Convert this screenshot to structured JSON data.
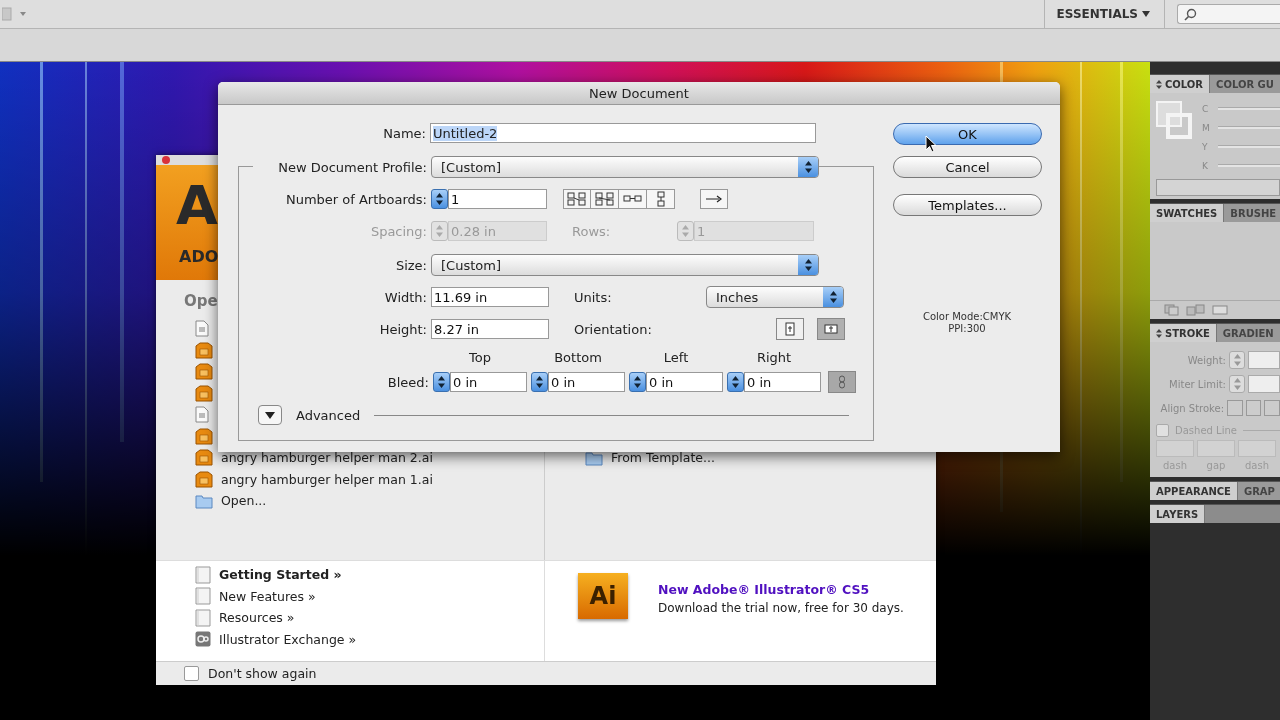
{
  "app_bar": {
    "workspace": "ESSENTIALS"
  },
  "welcome": {
    "logo_letter": "A",
    "logo_text": "ADO",
    "open_heading": "Ope",
    "recent_files": [
      {
        "kind": "doc"
      },
      {
        "kind": "ai"
      },
      {
        "kind": "ai"
      },
      {
        "kind": "ai"
      },
      {
        "kind": "doc"
      },
      {
        "kind": "ai"
      },
      {
        "kind": "ai",
        "name": "angry hamburger helper man 2.ai"
      },
      {
        "kind": "ai",
        "name": "angry hamburger helper man 1.ai"
      },
      {
        "kind": "folder",
        "name": "Open..."
      }
    ],
    "create_items": [
      {
        "kind": "folder",
        "name": "From Template..."
      }
    ],
    "links": [
      {
        "kind": "page",
        "label": "Getting Started »",
        "bold": true
      },
      {
        "kind": "page",
        "label": "New Features »",
        "bold": false
      },
      {
        "kind": "page",
        "label": "Resources »",
        "bold": false
      },
      {
        "kind": "exchange",
        "label": "Illustrator Exchange »",
        "bold": false
      }
    ],
    "promo": {
      "icon_text": "Ai",
      "title": "New Adobe® Illustrator® CS5",
      "text": "Download the trial now, free for 30 days."
    },
    "dont_show": {
      "label": "Don't show again",
      "checked": false
    }
  },
  "dialog": {
    "title": "New Document",
    "name_label": "Name:",
    "name_value": "Untitled-2",
    "profile_label": "New Document Profile:",
    "profile_value": "[Custom]",
    "artboards_label": "Number of Artboards:",
    "artboards_value": "1",
    "spacing": {
      "label": "Spacing:",
      "value": "0.28 in",
      "disabled": true
    },
    "rows": {
      "label": "Rows:",
      "value": "1",
      "disabled": true
    },
    "size_label": "Size:",
    "size_value": "[Custom]",
    "width_label": "Width:",
    "width_value": "11.69 in",
    "units_label": "Units:",
    "units_value": "Inches",
    "height_label": "Height:",
    "height_value": "8.27 in",
    "orientation_label": "Orientation:",
    "orientation": [
      {
        "kind": "portrait",
        "selected": false
      },
      {
        "kind": "landscape",
        "selected": true
      }
    ],
    "bleed_label": "Bleed:",
    "bleed": [
      {
        "label": "Top",
        "value": "0 in"
      },
      {
        "label": "Bottom",
        "value": "0 in"
      },
      {
        "label": "Left",
        "value": "0 in"
      },
      {
        "label": "Right",
        "value": "0 in"
      }
    ],
    "advanced_label": "Advanced",
    "buttons": [
      {
        "label": "OK",
        "default": true
      },
      {
        "label": "Cancel",
        "default": false
      },
      {
        "label": "Templates...",
        "default": false
      }
    ],
    "color_mode": "Color Mode:CMYK",
    "ppi": "PPI:300"
  },
  "panels": [
    {
      "kind": "color",
      "collapsible": true,
      "tabs": [
        {
          "label": "COLOR",
          "selected": true
        },
        {
          "label": "COLOR GU",
          "selected": false
        }
      ],
      "channels": [
        "C",
        "M",
        "Y",
        "K"
      ]
    },
    {
      "kind": "swatches",
      "collapsible": false,
      "tabs": [
        {
          "label": "SWATCHES",
          "selected": true
        },
        {
          "label": "BRUSHE",
          "selected": false
        }
      ]
    },
    {
      "kind": "stroke",
      "collapsible": true,
      "tabs": [
        {
          "label": "STROKE",
          "selected": true
        },
        {
          "label": "GRADIEN",
          "selected": false
        }
      ],
      "fields": [
        "Weight:",
        "Miter Limit:"
      ],
      "align_label": "Align Stroke:",
      "dashed": {
        "label": "Dashed Line",
        "checked": false
      },
      "dash_labels": [
        "dash",
        "gap",
        "dash"
      ]
    },
    {
      "kind": "appearance",
      "collapsible": false,
      "tabs": [
        {
          "label": "APPEARANCE",
          "selected": true
        },
        {
          "label": "GRAP",
          "selected": false
        }
      ]
    },
    {
      "kind": "layers",
      "collapsible": false,
      "tabs": [
        {
          "label": "LAYERS",
          "selected": true
        }
      ]
    }
  ]
}
